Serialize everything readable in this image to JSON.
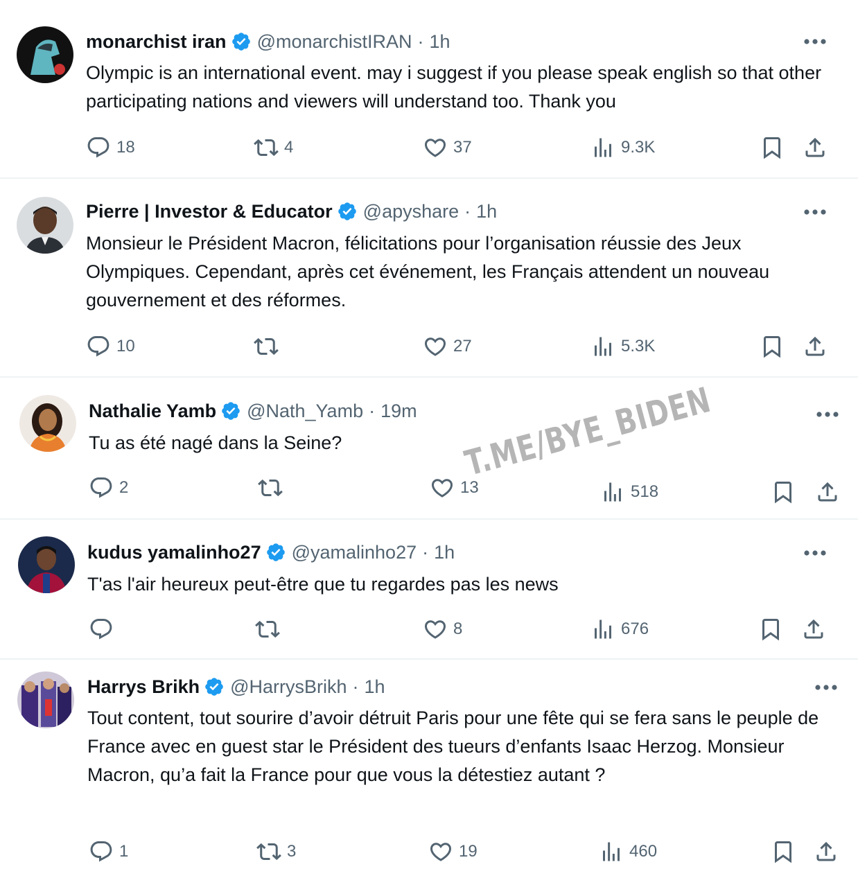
{
  "colors": {
    "text": "#0f1419",
    "muted": "#536471",
    "verified": "#1d9bf0",
    "divider": "#eff3f4"
  },
  "icons": {
    "verified": "verified-badge-icon",
    "reply": "reply-icon",
    "retweet": "retweet-icon",
    "like": "heart-icon",
    "views": "views-icon",
    "bookmark": "bookmark-icon",
    "share": "share-icon",
    "more": "more-icon"
  },
  "tweets": [
    {
      "name": "monarchist iran",
      "handle": "@monarchistIRAN",
      "separator": "·",
      "time": "1h",
      "text": "Olympic is an international event. may i suggest if you please speak english so that other participating nations and viewers will understand too. Thank you",
      "replies": "18",
      "retweets": "4",
      "likes": "37",
      "views": "9.3K"
    },
    {
      "name": "Pierre | Investor & Educator",
      "handle": "@apyshare",
      "separator": "·",
      "time": "1h",
      "text": "Monsieur le Président Macron, félicitations pour l’organisation réussie des Jeux Olympiques. Cependant, après cet événement, les Français attendent un nouveau gouvernement et des réformes.",
      "replies": "10",
      "retweets": "",
      "likes": "27",
      "views": "5.3K"
    },
    {
      "name": "Nathalie Yamb",
      "handle": "@Nath_Yamb",
      "separator": "·",
      "time": "19m",
      "text": "Tu as été nagé dans la Seine?",
      "replies": "2",
      "retweets": "",
      "likes": "13",
      "views": "518"
    },
    {
      "name": "kudus yamalinho27",
      "handle": "@yamalinho27",
      "separator": "·",
      "time": "1h",
      "text": "T'as l'air heureux peut-être que tu regardes pas les news",
      "replies": "",
      "retweets": "",
      "likes": "8",
      "views": "676"
    },
    {
      "name": "Harrys Brikh",
      "handle": "@HarrysBrikh",
      "separator": "·",
      "time": "1h",
      "text": "Tout content, tout sourire d’avoir détruit Paris pour une fête qui se fera sans le peuple de France avec en guest star le Président des tueurs d’enfants Isaac Herzog. Monsieur Macron, qu’a fait la France pour que vous la détestiez autant ?",
      "replies": "1",
      "retweets": "3",
      "likes": "19",
      "views": "460"
    }
  ],
  "watermark": "T.ME/BYE_BIDEN"
}
